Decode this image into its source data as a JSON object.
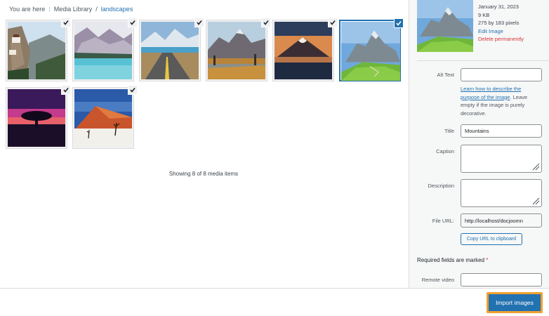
{
  "breadcrumb": {
    "prefix": "You are here",
    "separator": ":",
    "parent": "Media Library",
    "divider": "/",
    "current": "landscapes"
  },
  "media_items": [
    {
      "name": "cliff-monastery",
      "selected": false
    },
    {
      "name": "mountain-lake",
      "selected": false
    },
    {
      "name": "mountain-road",
      "selected": false
    },
    {
      "name": "autumn-mountains",
      "selected": false
    },
    {
      "name": "volcano-lake",
      "selected": false
    },
    {
      "name": "green-mountains",
      "selected": true
    },
    {
      "name": "sunset-tree",
      "selected": false
    },
    {
      "name": "desert-dunes",
      "selected": false
    }
  ],
  "count_text": "Showing 8 of 8 media items",
  "details": {
    "date": "January 31, 2023",
    "size": "9 KB",
    "dimensions": "275 by 183 pixels",
    "edit_link": "Edit Image",
    "delete_link": "Delete permanently"
  },
  "fields": {
    "alt_text_label": "Alt Text",
    "alt_text_value": "",
    "alt_help_link": "Learn how to describe the purpose of the image",
    "alt_help_rest": ". Leave empty if the image is purely decorative.",
    "title_label": "Title",
    "title_value": "Mountains",
    "caption_label": "Caption",
    "caption_value": "",
    "description_label": "Description",
    "description_value": "",
    "file_url_label": "File URL:",
    "file_url_value": "http://localhost/docjoomn",
    "copy_button": "Copy URL to clipboard",
    "required_text": "Required fields are marked",
    "required_star": "*",
    "remote_video_label": "Remote video",
    "remote_video_value": ""
  },
  "footer": {
    "import_button": "Import images"
  },
  "colors": {
    "accent": "#2271b1",
    "danger": "#d63638",
    "highlight": "#f0a030"
  },
  "icons": {
    "check": "checkmark-icon",
    "resize": "resize-handle-icon"
  }
}
